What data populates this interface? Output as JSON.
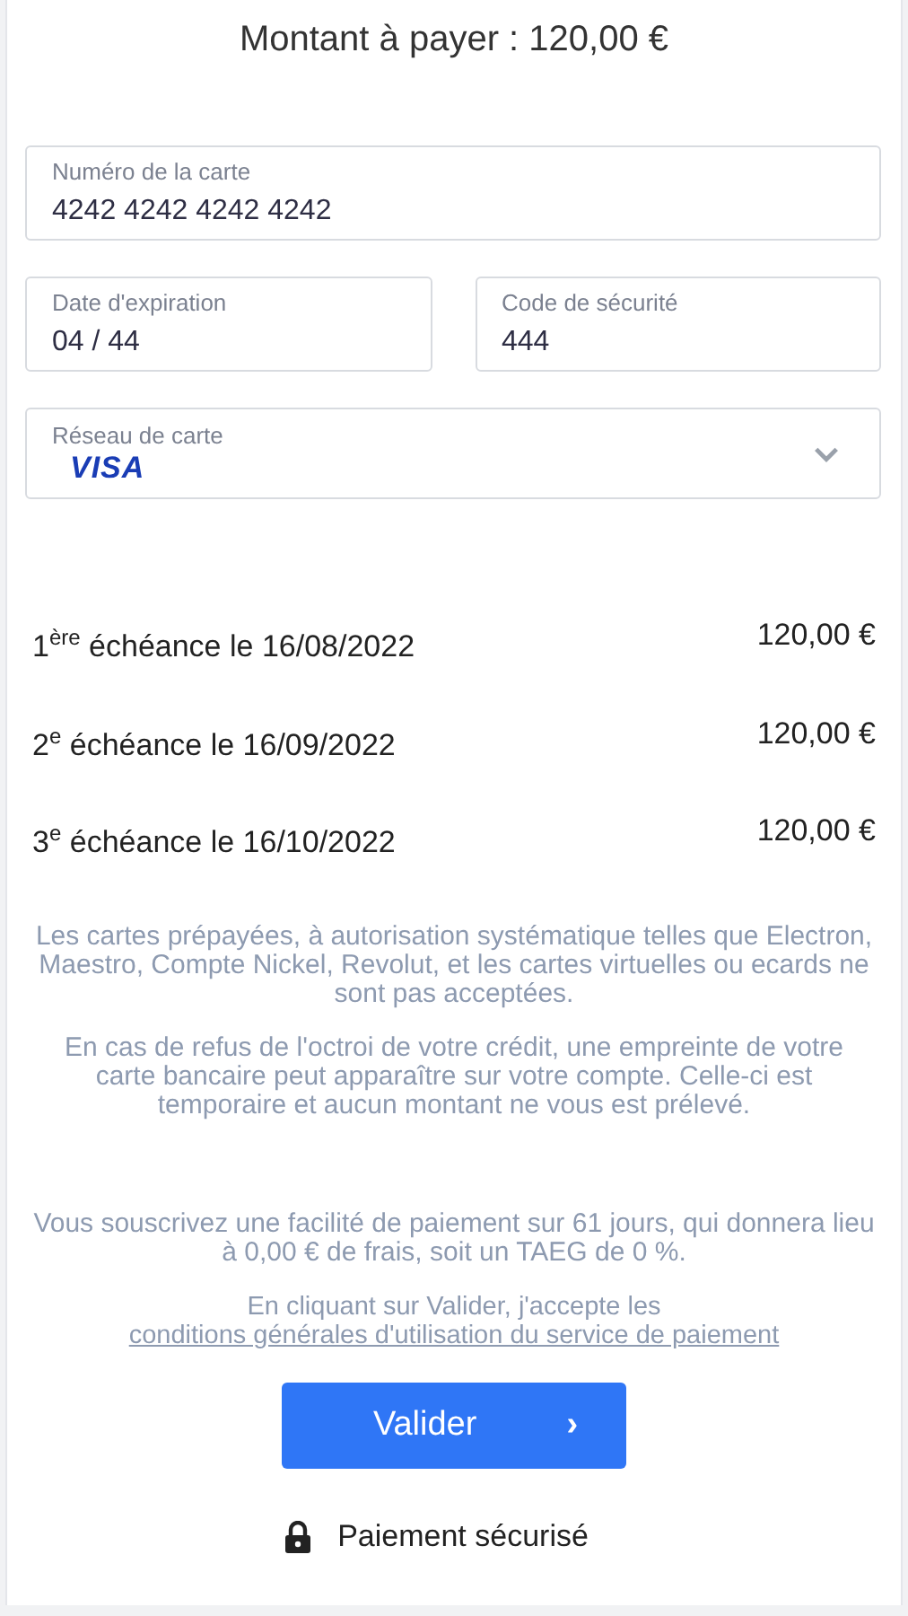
{
  "title": "Montant à payer : 120,00 €",
  "fields": [
    {
      "label": "Numéro de la carte",
      "value": "4242 4242 4242 4242",
      "kind": "text"
    },
    {
      "label": "Date d'expiration",
      "value": "04 / 44",
      "kind": "text"
    },
    {
      "label": "Code de sécurité",
      "value": "444",
      "kind": "text"
    },
    {
      "label": "Réseau de carte",
      "value": "VISA",
      "kind": "select"
    }
  ],
  "installments": [
    {
      "label": "1$^{ère}$ échéance le 16/08/2022",
      "amount": "120,00 €"
    },
    {
      "label": "2$^{e}$ échéance le 16/09/2022",
      "amount": "120,00 €"
    },
    {
      "label": "3$^{e}$ échéance le 16/10/2022",
      "amount": "120,00 €"
    }
  ],
  "notes": [
    "Les cartes prépayées, à autorisation systématique telles que Electron, Maestro, Compte Nickel, Revolut, et les cartes virtuelles ou ecards ne sont pas acceptées.",
    "En cas de refus de l'octroi de votre crédit, une empreinte de votre carte bancaire peut apparaître sur votre compte. Celle-ci est temporaire et aucun montant ne vous est prélevé."
  ],
  "terms": "Vous souscrivez une facilité de paiement sur 61 jours, qui donnera lieu à 0,00 € de frais, soit un TAEG de 0 %.",
  "consent": {
    "text": "En cliquant sur Valider, j'accepte les",
    "link": "conditions générales d'utilisation du service de paiement"
  },
  "submit": {
    "label": "Valider",
    "arrow": "›"
  },
  "secure": "Paiement sécurisé"
}
